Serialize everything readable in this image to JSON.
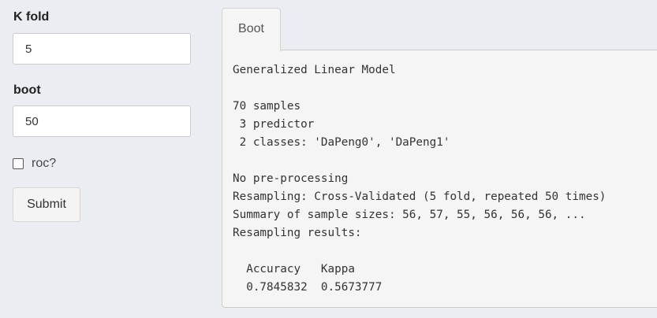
{
  "sidebar": {
    "kfold": {
      "label": "K fold",
      "value": "5"
    },
    "boot": {
      "label": "boot",
      "value": "50"
    },
    "roc": {
      "label": "roc?",
      "checked": false
    },
    "submit_label": "Submit"
  },
  "tabs": [
    {
      "label": "Boot",
      "active": true
    }
  ],
  "output": {
    "text": "Generalized Linear Model\n\n70 samples\n 3 predictor\n 2 classes: 'DaPeng0', 'DaPeng1'\n\nNo pre-processing\nResampling: Cross-Validated (5 fold, repeated 50 times)\nSummary of sample sizes: 56, 57, 55, 56, 56, 56, ...\nResampling results:\n\n  Accuracy   Kappa    \n  0.7845832  0.5673777"
  }
}
